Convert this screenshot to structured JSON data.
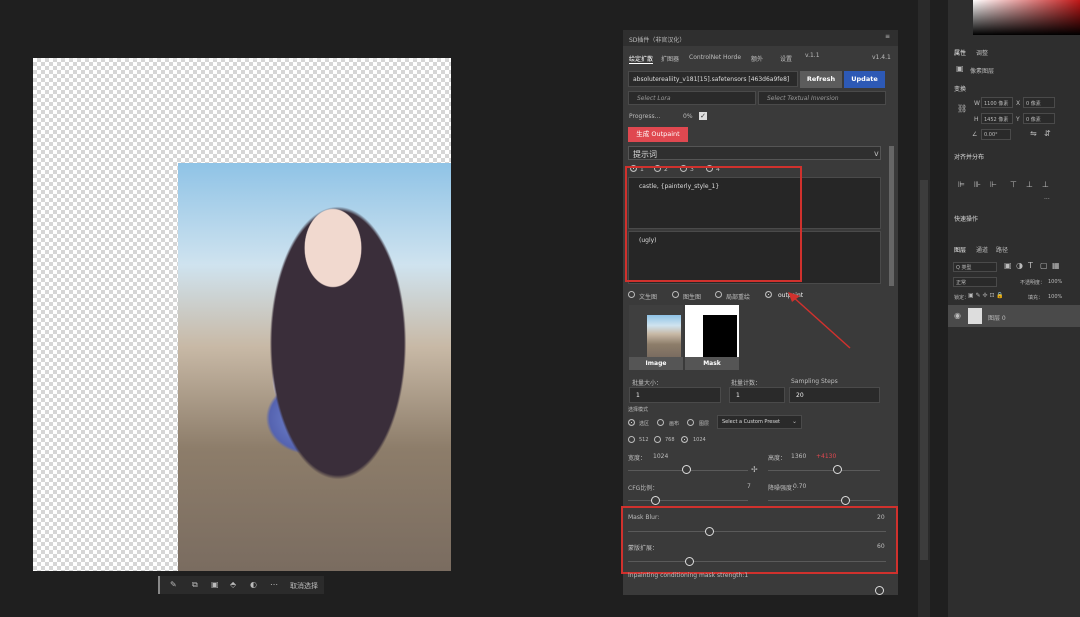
{
  "canvas": {
    "toolbar": {
      "icons": [
        "brush-icon",
        "crop-icon",
        "stamp-icon",
        "selection-icon",
        "mask-icon",
        "more-icon"
      ],
      "cancel_label": "取消选择"
    }
  },
  "sd_panel": {
    "title": "SD插件（非官汉化）",
    "tabs": [
      "绘定扩散",
      "扩图器",
      "ControlNet",
      "Horde",
      "额外",
      "设置"
    ],
    "version_a": "v.1.1",
    "version": "v1.4.1",
    "model": "absoluterealiity_v181[15].safetensors [463d6a9fe8]",
    "refresh_label": "Refresh",
    "update_label": "Update",
    "lora_placeholder": "Select Lora",
    "textual_placeholder": "Select Textual Inversion",
    "progress_label": "Progress...",
    "progress_value": "0%",
    "generate_label": "生成 Outpaint",
    "prompt_header": "提示词",
    "prompt_tabs": [
      "1",
      "2",
      "3",
      "4"
    ],
    "positive_prompt": "castle, {painterly_style_1}",
    "negative_prompt": "(ugly)",
    "modes": [
      "文生图",
      "图生图",
      "局部重绘",
      "outpaint"
    ],
    "selected_mode": "outpaint",
    "image_label": "Image",
    "mask_label": "Mask",
    "batch_size_label": "批量大小：",
    "batch_size": "1",
    "batch_count_label": "批量计数：",
    "batch_count": "1",
    "sampling_label": "Sampling Steps",
    "sampling_steps": "20",
    "selection_mode_label": "选择模式",
    "selection_options": [
      "选区",
      "画布",
      "图层"
    ],
    "preset_label": "Select a Custom Preset",
    "res_options": [
      "512",
      "768",
      "1024"
    ],
    "width_label": "宽度：",
    "width_value": "1024",
    "height_label": "高度：",
    "height_value": "1360",
    "height_extra": "+4130",
    "cfg_label": "CFG比例：",
    "cfg_value": "7",
    "denoise_label": "降噪强度：",
    "denoise_value": "0.70",
    "mask_blur_label": "Mask Blur:",
    "mask_blur_value": "20",
    "mask_expand_label": "蒙版扩展：",
    "mask_expand_value": "60",
    "conditioning_label": "Inpainting conditioning mask strength:1"
  },
  "ps_panel": {
    "tabs_top": [
      "属性",
      "调整"
    ],
    "pixel_layer_label": "像素图层",
    "transform_label": "变换",
    "w_value": "1100 像素",
    "h_value": "1452 像素",
    "x_value": "0 像素",
    "y_value": "0 像素",
    "angle": "0.00°",
    "align_label": "对齐并分布",
    "quick_label": "快速操作",
    "layer_tabs": [
      "图层",
      "通道",
      "路径"
    ],
    "kind_label": "Q 类型",
    "blend_mode": "正常",
    "opacity_label": "不透明度：",
    "opacity_value": "100%",
    "lock_label": "锁定：",
    "fill_label": "填充：",
    "fill_value": "100%",
    "layer_name": "图层 0",
    "colors": {
      "accent_blue": "#2d59b5",
      "red_button": "#e04850",
      "annotation_red": "#d0312d"
    }
  }
}
